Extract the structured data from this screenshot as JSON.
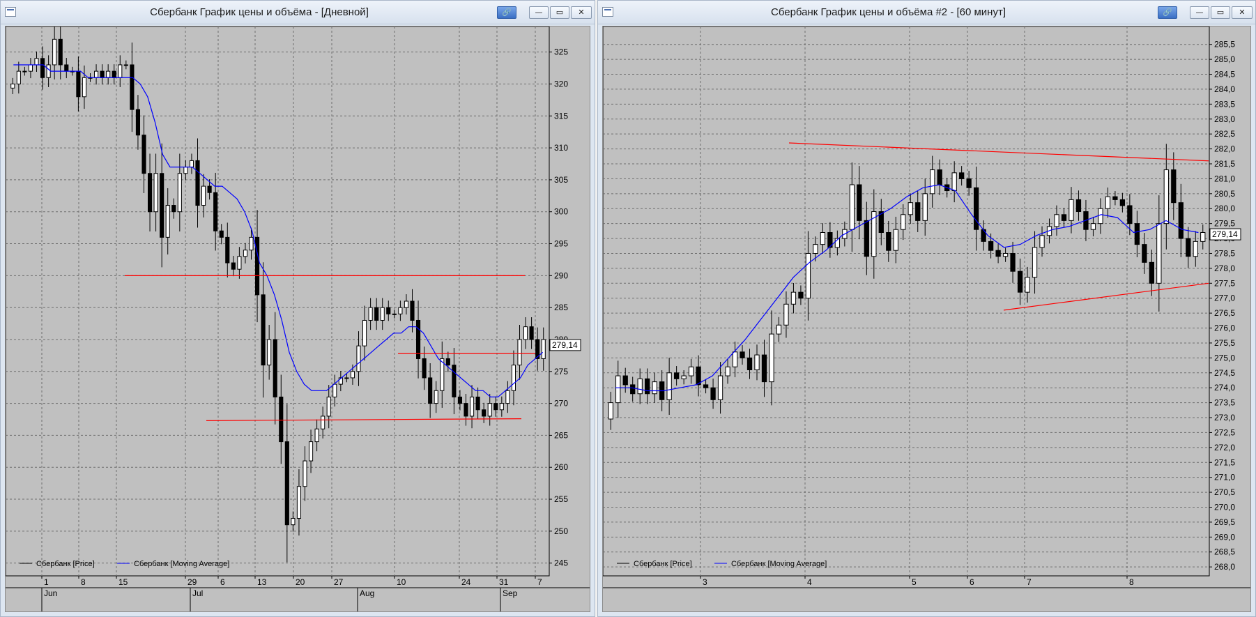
{
  "left": {
    "title": "Сбербанк График цены и объёма - [Дневной]",
    "buttons": {
      "link": "🔗",
      "minimize": "—",
      "restore": "▭",
      "close": "✕"
    },
    "legend": [
      "Сбербанк [Price]",
      "Сбербанк [Moving Average]"
    ],
    "price_label": "279,14",
    "x_days": [
      "1",
      "8",
      "15",
      "29",
      "6",
      "13",
      "20",
      "27",
      "10",
      "24",
      "31",
      "7"
    ],
    "x_months": [
      "Jun",
      "Jul",
      "Aug",
      "Sep"
    ],
    "y_ticks": [
      "325",
      "320",
      "315",
      "310",
      "305",
      "300",
      "295",
      "290",
      "285",
      "280",
      "275",
      "270",
      "265",
      "260",
      "255",
      "250",
      "245"
    ]
  },
  "right": {
    "title": "Сбербанк График цены и объёма #2 - [60 минут]",
    "buttons": {
      "link": "🔗",
      "minimize": "—",
      "restore": "▭",
      "close": "✕"
    },
    "legend": [
      "Сбербанк [Price]",
      "Сбербанк [Moving Average]"
    ],
    "price_label": "279,14",
    "x_days": [
      "3",
      "4",
      "5",
      "6",
      "7",
      "8"
    ],
    "y_ticks": [
      "285,5",
      "285,0",
      "284,5",
      "284,0",
      "283,5",
      "283,0",
      "282,5",
      "282,0",
      "281,5",
      "281,0",
      "280,5",
      "280,0",
      "279,5",
      "279,0",
      "278,5",
      "278,0",
      "277,5",
      "277,0",
      "276,5",
      "276,0",
      "275,5",
      "275,0",
      "274,5",
      "274,0",
      "273,5",
      "273,0",
      "272,5",
      "272,0",
      "271,5",
      "271,0",
      "270,5",
      "270,0",
      "269,5",
      "269,0",
      "268,5",
      "268,0"
    ]
  },
  "colors": {
    "chart_bg": "#c0c0c0",
    "moving_average": "#0000ff",
    "trend_line": "#ff0000",
    "price": "#000000"
  },
  "chart_data": [
    {
      "type": "candlestick",
      "title": "Сбербанк График цены и объёма - [Дневной]",
      "ylim": [
        243,
        329
      ],
      "series": [
        {
          "name": "Сбербанк [Price]",
          "close": [
            320,
            322,
            322,
            323,
            324,
            321,
            323,
            327,
            323,
            322,
            322,
            318,
            321,
            321,
            322,
            321,
            322,
            321,
            323,
            323,
            316,
            312,
            306,
            300,
            306,
            296,
            301,
            300,
            306,
            307,
            308,
            301,
            304,
            303,
            297,
            296,
            292,
            291,
            293,
            294,
            296,
            287,
            276,
            280,
            271,
            264,
            251,
            252,
            257,
            261,
            264,
            266,
            268,
            271,
            273,
            274,
            274,
            275,
            279,
            283,
            285,
            283,
            285,
            284,
            284,
            285,
            286,
            283,
            277,
            274,
            270,
            272,
            277,
            276,
            271,
            270,
            268,
            271,
            269,
            268,
            270,
            269,
            270,
            272,
            276,
            280,
            282,
            280,
            277,
            280
          ]
        },
        {
          "name": "Сбербанк [Moving Average]",
          "values": [
            323,
            323,
            323,
            323,
            323,
            322,
            322,
            322,
            322,
            322,
            321,
            321,
            321,
            321,
            321,
            321,
            321,
            320,
            318,
            314,
            309,
            307,
            307,
            307,
            307,
            306,
            305,
            304,
            304,
            303,
            302,
            300,
            297,
            292,
            290,
            287,
            283,
            278,
            275,
            273,
            272,
            272,
            272,
            273,
            274,
            275,
            276,
            277,
            278,
            279,
            280,
            281,
            281,
            282,
            282,
            281,
            279,
            277,
            276,
            275,
            274,
            273,
            272,
            272,
            271,
            271,
            272,
            273,
            274,
            276,
            277,
            278
          ]
        }
      ]
    },
    {
      "type": "candlestick",
      "title": "Сбербанк График цены и объёма #2 - [60 минут]",
      "ylim": [
        267.7,
        286.1
      ],
      "series": [
        {
          "name": "Сбербанк [Price]",
          "close": [
            273.5,
            274.4,
            274.1,
            273.8,
            274.3,
            273.8,
            274.2,
            273.6,
            274.5,
            274.3,
            274.4,
            274.7,
            274.1,
            274.0,
            273.6,
            274.4,
            274.7,
            275.2,
            275.0,
            274.6,
            275.1,
            274.2,
            275.8,
            276.1,
            276.8,
            277.2,
            277.0,
            278.5,
            278.8,
            279.2,
            278.7,
            279.0,
            279.3,
            280.8,
            279.6,
            278.4,
            279.9,
            279.2,
            278.6,
            279.3,
            279.8,
            280.2,
            279.6,
            280.5,
            281.3,
            280.8,
            280.6,
            281.2,
            281.0,
            280.7,
            279.3,
            278.9,
            278.6,
            278.4,
            278.5,
            277.9,
            277.2,
            277.7,
            278.7,
            279.1,
            279.4,
            279.8,
            279.6,
            280.3,
            279.9,
            279.3,
            279.5,
            280.0,
            280.4,
            280.3,
            280.1,
            279.5,
            278.8,
            278.2,
            277.5,
            279.5,
            281.3,
            280.2,
            279.0,
            278.4,
            278.9,
            279.2
          ]
        },
        {
          "name": "Сбербанк [Moving Average]",
          "values": [
            274.0,
            274.0,
            273.9,
            273.9,
            274.0,
            274.1,
            274.4,
            275.0,
            275.6,
            276.3,
            277.0,
            277.7,
            278.2,
            278.6,
            279.1,
            279.4,
            279.7,
            280.0,
            280.4,
            280.7,
            280.8,
            280.6,
            279.8,
            279.1,
            278.7,
            278.8,
            279.1,
            279.3,
            279.4,
            279.6,
            279.8,
            279.7,
            279.2,
            279.3,
            279.6,
            279.3,
            279.2
          ]
        }
      ]
    }
  ]
}
